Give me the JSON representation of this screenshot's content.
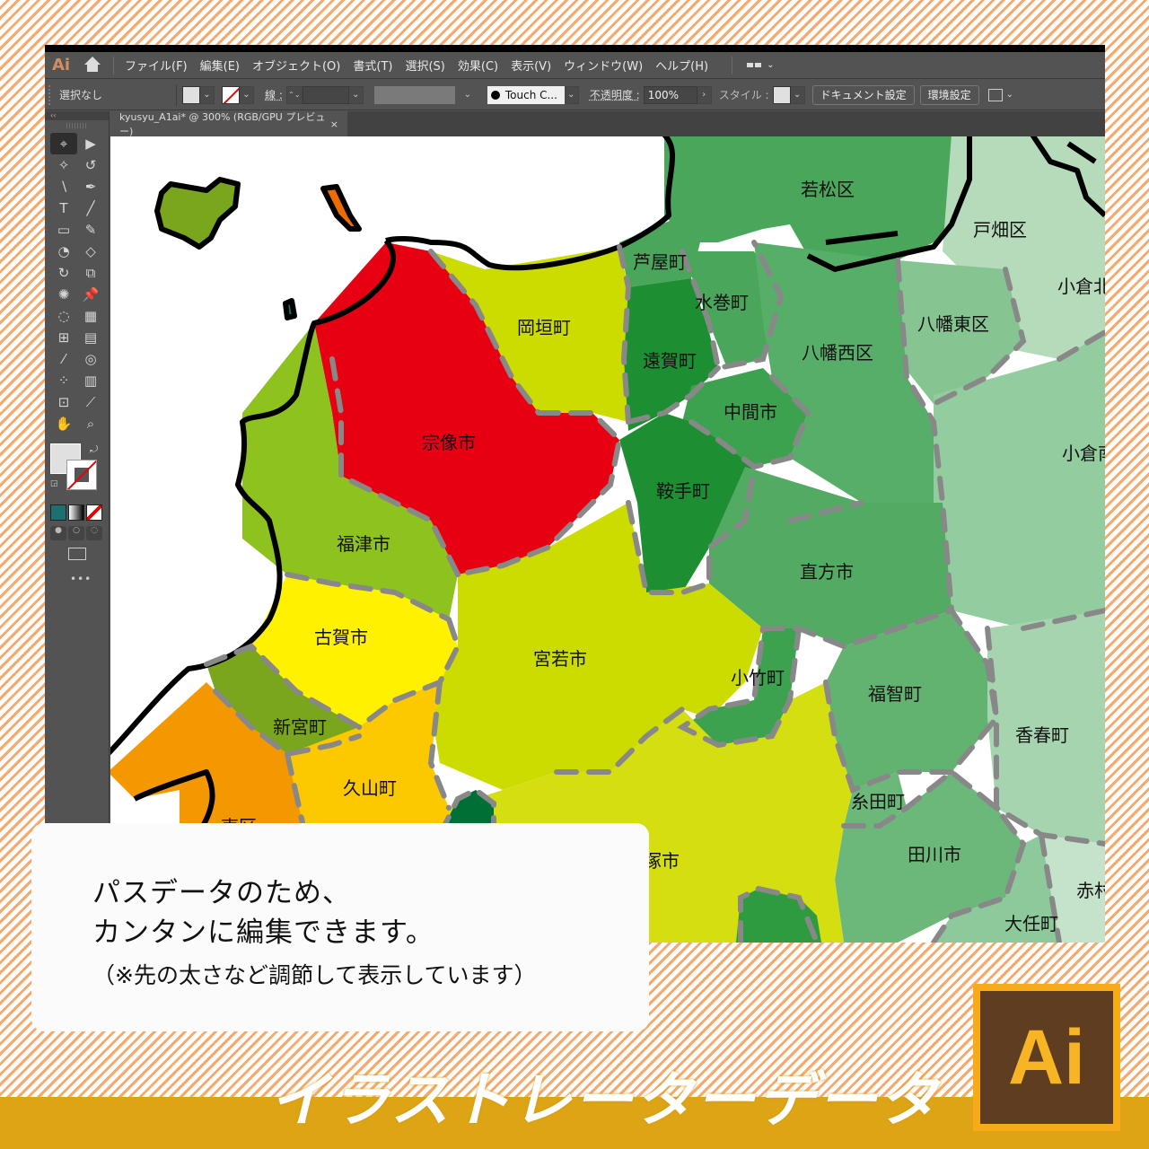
{
  "app": {
    "logo": "Ai",
    "menu": [
      "ファイル(F)",
      "編集(E)",
      "オブジェクト(O)",
      "書式(T)",
      "選択(S)",
      "効果(C)",
      "表示(V)",
      "ウィンドウ(W)",
      "ヘルプ(H)"
    ]
  },
  "control_bar": {
    "selection": "選択なし",
    "stroke_label": "線 :",
    "brush_name": "Touch C...",
    "opacity_label": "不透明度 :",
    "opacity_value": "100%",
    "style_label": "スタイル :",
    "doc_settings_button": "ドキュメント設定",
    "preferences_button": "環境設定"
  },
  "document_tab": {
    "title": "kyusyu_A1ai* @ 300% (RGB/GPU プレビュー)",
    "close": "×"
  },
  "map": {
    "regions": [
      {
        "name": "若松区",
        "color": "#4aa65a"
      },
      {
        "name": "戸畑区",
        "color": "#b5dbbb"
      },
      {
        "name": "小倉北区",
        "color": "#b5dbbb"
      },
      {
        "name": "芦屋町",
        "color": "#4aa65a"
      },
      {
        "name": "水巻町",
        "color": "#4aa65a"
      },
      {
        "name": "八幡東区",
        "color": "#86c592"
      },
      {
        "name": "八幡西区",
        "color": "#57ae68"
      },
      {
        "name": "岡垣町",
        "color": "#cddc00"
      },
      {
        "name": "遠賀町",
        "color": "#1e8e33"
      },
      {
        "name": "中間市",
        "color": "#3da24f"
      },
      {
        "name": "小倉南区",
        "color": "#93cc9f"
      },
      {
        "name": "宗像市",
        "color": "#e60012"
      },
      {
        "name": "鞍手町",
        "color": "#1e8e33"
      },
      {
        "name": "福津市",
        "color": "#8dc21f"
      },
      {
        "name": "直方市",
        "color": "#52aa63"
      },
      {
        "name": "古賀市",
        "color": "#fff100"
      },
      {
        "name": "宮若市",
        "color": "#cddc00"
      },
      {
        "name": "小竹町",
        "color": "#3da24f"
      },
      {
        "name": "福智町",
        "color": "#62b370"
      },
      {
        "name": "新宮町",
        "color": "#7aa61e"
      },
      {
        "name": "香春町",
        "color": "#a6d4ae"
      },
      {
        "name": "久山町",
        "color": "#fcc800"
      },
      {
        "name": "糸田町",
        "color": "#6cb87a"
      },
      {
        "name": "東区",
        "color": "#f39800"
      },
      {
        "name": "田川市",
        "color": "#6cb87a"
      },
      {
        "name": "飯塚市",
        "color": "#d4de10"
      },
      {
        "name": "赤村",
        "color": "#c5e3cb"
      },
      {
        "name": "大任町",
        "color": "#8dc99a"
      }
    ]
  },
  "info_card": {
    "line1": "パスデータのため、",
    "line2": "カンタンに編集できます。",
    "line3": "（※先の太さなど調節して表示しています）"
  },
  "banner": {
    "title": "イラストレーターデータ",
    "badge": "Ai"
  }
}
